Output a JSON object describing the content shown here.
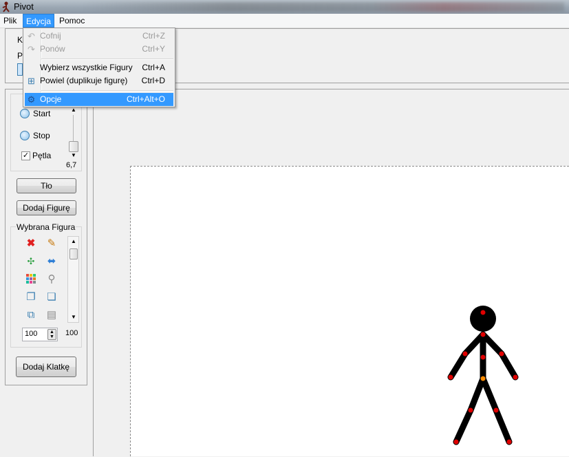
{
  "window": {
    "title": "Pivot"
  },
  "menubar": {
    "items": [
      "Plik",
      "Edycja",
      "Pomoc"
    ]
  },
  "top_panel": {
    "label_k": "K",
    "label_p": "P"
  },
  "playback": {
    "start_label": "Start",
    "stop_label": "Stop",
    "loop_label": "Pętla",
    "loop_checked": true,
    "speed_value": "6,7"
  },
  "buttons": {
    "background": "Tło",
    "add_figure": "Dodaj Figurę",
    "add_frame": "Dodaj Klatkę"
  },
  "selected_figure": {
    "title": "Wybrana Figura",
    "size_input": "100",
    "size_value": "100",
    "tools": [
      "delete-icon",
      "edit-pencil-icon",
      "center-icon",
      "flip-icon",
      "color-icon",
      "join-icon",
      "bring-front-icon",
      "send-back-icon",
      "copy-icon",
      "paste-icon"
    ]
  },
  "edit_menu": {
    "items": [
      {
        "label": "Cofnij",
        "shortcut": "Ctrl+Z",
        "icon": "undo-icon",
        "enabled": false
      },
      {
        "label": "Ponów",
        "shortcut": "Ctrl+Y",
        "icon": "redo-icon",
        "enabled": false
      },
      {
        "label": "Wybierz wszystkie Figury",
        "shortcut": "Ctrl+A",
        "icon": "",
        "enabled": true
      },
      {
        "label": "Powiel (duplikuje figurę)",
        "shortcut": "Ctrl+D",
        "icon": "duplicate-icon",
        "enabled": true
      },
      {
        "label": "Opcje",
        "shortcut": "Ctrl+Alt+O",
        "icon": "options-gear-icon",
        "enabled": true,
        "highlighted": true
      }
    ]
  },
  "colors": {
    "accent": "#3399ff",
    "figure": "#000000",
    "joint": "#e00000",
    "joint_center": "#ff8c00"
  }
}
